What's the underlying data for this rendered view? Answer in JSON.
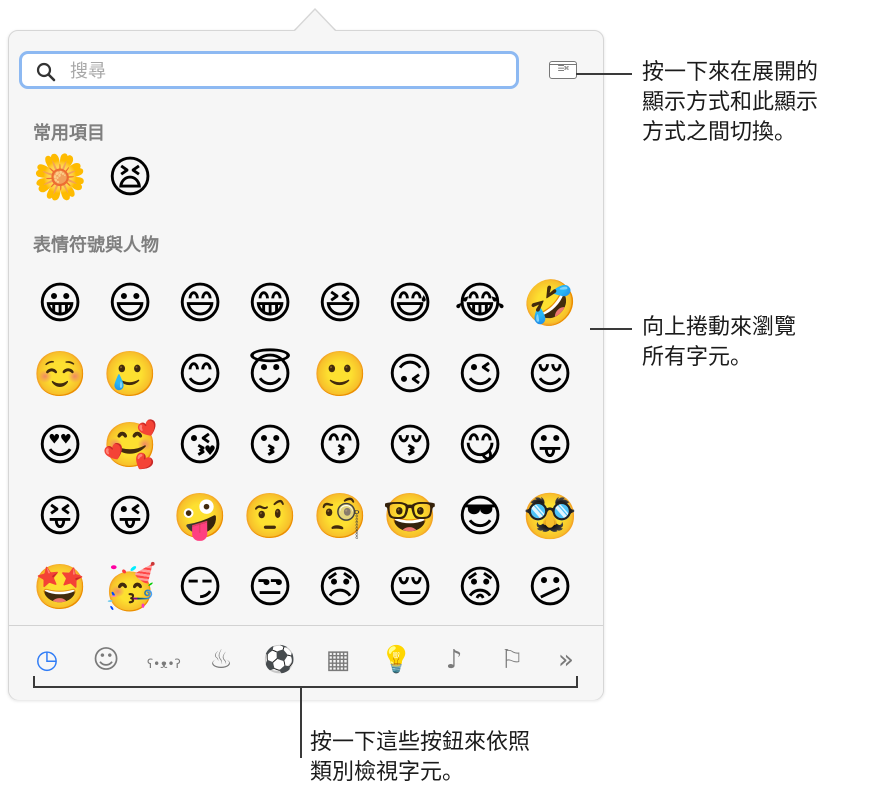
{
  "search": {
    "placeholder": "搜尋",
    "value": ""
  },
  "view_toggle": {
    "label": "☰⌘"
  },
  "frequent": {
    "title": "常用項目",
    "emojis": [
      "🌼",
      "😫"
    ]
  },
  "smileys": {
    "title": "表情符號與人物",
    "rows": [
      [
        "😀",
        "😃",
        "😄",
        "😁",
        "😆",
        "😅",
        "😂",
        "🤣"
      ],
      [
        "☺️",
        "🥲",
        "😊",
        "😇",
        "🙂",
        "🙃",
        "😉",
        "😌"
      ],
      [
        "😍",
        "🥰",
        "😘",
        "😗",
        "😙",
        "😚",
        "😋",
        "😛"
      ],
      [
        "😝",
        "😜",
        "🤪",
        "🤨",
        "🧐",
        "🤓",
        "😎",
        "🥸"
      ],
      [
        "🤩",
        "🥳",
        "😏",
        "😒",
        "😞",
        "😔",
        "😟",
        "😕"
      ],
      [
        "🙁",
        "☹️",
        "😣",
        "😖",
        "😫",
        "😩",
        "🥺",
        "😢"
      ]
    ]
  },
  "tabs": [
    {
      "name": "tab-recent",
      "icon": "clock-icon",
      "glyph": "◷",
      "active": true
    },
    {
      "name": "tab-smileys",
      "icon": "smiley-icon",
      "glyph": "☺",
      "active": false
    },
    {
      "name": "tab-animals",
      "icon": "bear-icon",
      "glyph": "ʕ•ᴥ•ʔ",
      "active": false
    },
    {
      "name": "tab-food",
      "icon": "burger-icon",
      "glyph": "♨",
      "active": false
    },
    {
      "name": "tab-activity",
      "icon": "soccer-ball-icon",
      "glyph": "⚽",
      "active": false
    },
    {
      "name": "tab-travel",
      "icon": "building-icon",
      "glyph": "▦",
      "active": false
    },
    {
      "name": "tab-objects",
      "icon": "lightbulb-icon",
      "glyph": "💡",
      "active": false
    },
    {
      "name": "tab-symbols",
      "icon": "symbols-icon",
      "glyph": "♪",
      "active": false
    },
    {
      "name": "tab-flags",
      "icon": "flag-icon",
      "glyph": "⚐",
      "active": false
    },
    {
      "name": "tab-more",
      "icon": "double-chevron-icon",
      "glyph": "»",
      "active": false
    }
  ],
  "callouts": {
    "toggle": "按一下來在展開的\n顯示方式和此顯示\n方式之間切換。",
    "scroll": "向上捲動來瀏覽\n所有字元。",
    "categories": "按一下這些按鈕來依照\n類別檢視字元。"
  },
  "colors": {
    "accent": "#2f7cf6",
    "search_focus": "#8db9f2"
  }
}
